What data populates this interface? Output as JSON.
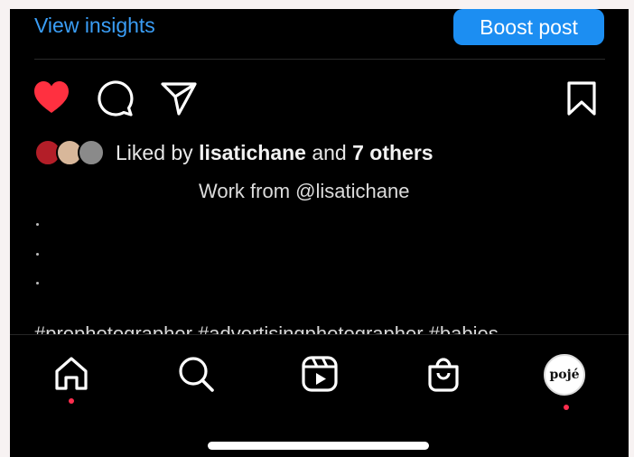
{
  "header": {
    "view_insights": "View insights",
    "boost_post": "Boost post"
  },
  "actions": {
    "liked": true,
    "like_color": "#ff3040",
    "icons": [
      "heart-icon",
      "comment-icon",
      "share-icon",
      "bookmark-icon"
    ]
  },
  "likes": {
    "prefix": "Liked by ",
    "user": "lisatichane",
    "middle": " and ",
    "others": "7 others"
  },
  "caption": {
    "text": "Work from @lisatichane",
    "hashtags": "#prophotographer #advertisingphotographer #babies"
  },
  "nav": {
    "items": [
      "home-icon",
      "search-icon",
      "reels-icon",
      "shop-icon",
      "profile"
    ],
    "profile_initials": "pojé",
    "notification_color": "#ff2e4e"
  },
  "colors": {
    "accent": "#1c8ef2",
    "link": "#3a9df5",
    "background": "#000000"
  }
}
